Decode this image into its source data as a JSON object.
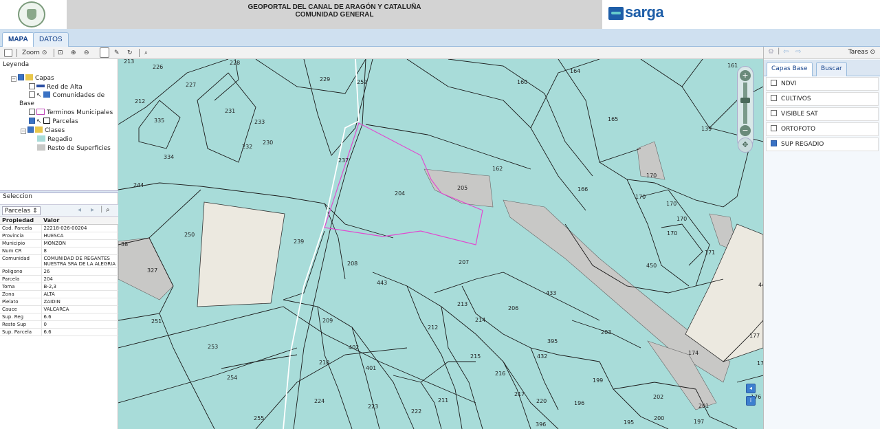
{
  "header": {
    "title_line1": "GEOPORTAL DEL CANAL DE ARAGÓN Y CATALUÑA",
    "title_line2": "COMUNIDAD GENERAL",
    "brand": "sarga"
  },
  "tabs": [
    {
      "label": "MAPA",
      "active": true
    },
    {
      "label": "DATOS",
      "active": false
    }
  ],
  "toolbar": {
    "zoom_label": "Zoom"
  },
  "legend": {
    "title": "Leyenda",
    "items": [
      {
        "label": "Capas"
      },
      {
        "label": "Red de Alta"
      },
      {
        "label": "Comunidades de"
      },
      {
        "label": "Base"
      },
      {
        "label": "Terminos Municipales"
      },
      {
        "label": "Parcelas"
      },
      {
        "label": "Clases"
      },
      {
        "label": "Regadio"
      },
      {
        "label": "Resto de Superficies"
      }
    ]
  },
  "selection": {
    "title": "Seleccion",
    "dropdown": "Parcelas ⇕",
    "col_property": "Propiedad",
    "col_value": "Valor",
    "rows": [
      {
        "k": "Cod. Parcela",
        "v": "22218-026-00204"
      },
      {
        "k": "Provincia",
        "v": "HUESCA"
      },
      {
        "k": "Municipio",
        "v": "MONZON"
      },
      {
        "k": "Num CR",
        "v": "8"
      },
      {
        "k": "Comunidad",
        "v": "COMUNIDAD DE REGANTES NUESTRA SRA DE LA ALEGRIA"
      },
      {
        "k": "Poligono",
        "v": "26"
      },
      {
        "k": "Parcela",
        "v": "204"
      },
      {
        "k": "Toma",
        "v": "B-2,3"
      },
      {
        "k": "Zona",
        "v": "ALTA"
      },
      {
        "k": "Pielato",
        "v": "ZAIDIN"
      },
      {
        "k": "Cauce",
        "v": "VALCARCA"
      },
      {
        "k": "Sup. Reg",
        "v": "6.6"
      },
      {
        "k": "Resto Sup",
        "v": "0"
      },
      {
        "k": "Sup. Parcela",
        "v": "6.6"
      }
    ]
  },
  "right_panel": {
    "tareas": "Tareas",
    "tabs": [
      {
        "label": "Capas Base",
        "active": true
      },
      {
        "label": "Buscar",
        "active": false
      }
    ],
    "layers": [
      {
        "label": "NDVI",
        "checked": false
      },
      {
        "label": "CULTIVOS",
        "checked": false
      },
      {
        "label": "VISIBLE SAT",
        "checked": false
      },
      {
        "label": "ORTOFOTO",
        "checked": false
      },
      {
        "label": "SUP REGADIO",
        "checked": true
      }
    ]
  },
  "map": {
    "parcel_labels": [
      "213",
      "226",
      "228",
      "229",
      "252",
      "164",
      "160",
      "161",
      "227",
      "212",
      "231",
      "233",
      "335",
      "232",
      "230",
      "334",
      "237",
      "165",
      "139",
      "204",
      "205",
      "162",
      "244",
      "166",
      "170",
      "170",
      "170",
      "170",
      "170",
      "250",
      "239",
      "208",
      "207",
      "450",
      "171",
      "327",
      "443",
      "433",
      "44",
      "213",
      "206",
      "214",
      "203",
      "251",
      "212",
      "209",
      "395",
      "177",
      "253",
      "402",
      "432",
      "174",
      "215",
      "210",
      "401",
      "216",
      "199",
      "17",
      "254",
      "224",
      "223",
      "222",
      "211",
      "217",
      "220",
      "196",
      "202",
      "201",
      "176",
      "255",
      "396",
      "195",
      "200",
      "197",
      "38"
    ]
  },
  "colors": {
    "regadio": "#a8dcd9",
    "resto": "#c8c8c6",
    "light_parcel": "#ece9e0",
    "selected_outline": "#e04ad0"
  }
}
